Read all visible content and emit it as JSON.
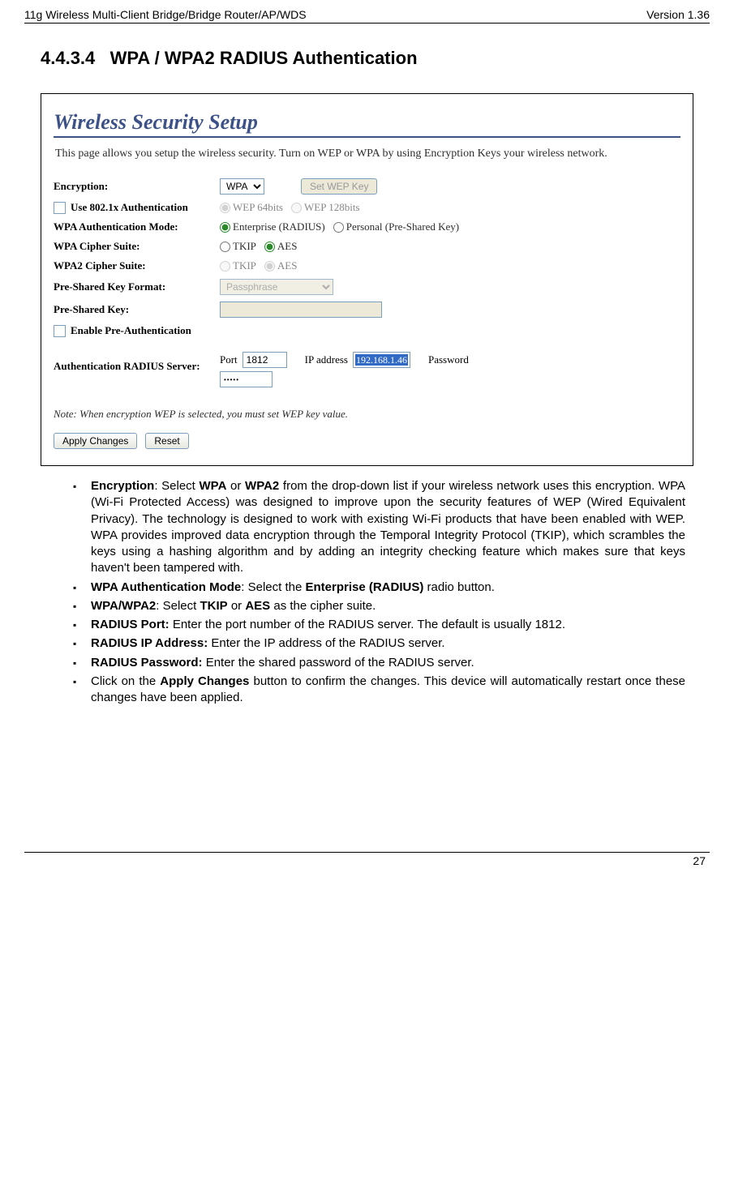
{
  "header": {
    "left": "11g Wireless Multi-Client Bridge/Bridge Router/AP/WDS",
    "right": "Version 1.36"
  },
  "section": {
    "number": "4.4.3.4",
    "title": "WPA / WPA2 RADIUS Authentication"
  },
  "screenshot": {
    "title": "Wireless Security Setup",
    "intro": "This page allows you setup the wireless security. Turn on WEP or WPA by using Encryption Keys your wireless network.",
    "encryption_label": "Encryption:",
    "encryption_value": "WPA",
    "setwepkey_btn": "Set WEP Key",
    "use8021x_label": "Use 802.1x Authentication",
    "wep64_label": "WEP 64bits",
    "wep128_label": "WEP 128bits",
    "wpa_auth_mode_label": "WPA Authentication Mode:",
    "enterprise_label": "Enterprise (RADIUS)",
    "personal_label": "Personal (Pre-Shared Key)",
    "wpa_cipher_label": "WPA Cipher Suite:",
    "wpa2_cipher_label": "WPA2 Cipher Suite:",
    "tkip_label": "TKIP",
    "aes_label": "AES",
    "psk_format_label": "Pre-Shared Key Format:",
    "psk_format_value": "Passphrase",
    "psk_label": "Pre-Shared Key:",
    "enable_preauth_label": "Enable Pre-Authentication",
    "radius_server_label": "Authentication RADIUS Server:",
    "port_label": "Port",
    "port_value": "1812",
    "ip_label": "IP address",
    "ip_value": "192.168.1.46",
    "password_label": "Password",
    "password_value": "•••••",
    "note": "Note: When encryption WEP is selected, you must set WEP key value.",
    "apply_btn": "Apply Changes",
    "reset_btn": "Reset"
  },
  "bullets": {
    "b1_strong": "Encryption",
    "b1_text1": ": Select ",
    "b1_wpa": "WPA",
    "b1_text2": " or ",
    "b1_wpa2": "WPA2",
    "b1_text3": " from the drop-down list if your wireless network uses this encryption. WPA (Wi-Fi Protected Access) was designed to improve upon the security features of WEP (Wired Equivalent Privacy). The technology is designed to work with existing Wi-Fi products that have been enabled with WEP. WPA provides improved data encryption through the Temporal Integrity Protocol (TKIP), which scrambles the keys using a hashing algorithm and by adding an integrity checking feature which makes sure that keys haven't been tampered with.",
    "b2_strong": "WPA Authentication Mode",
    "b2_text1": ": Select the ",
    "b2_enterprise": "Enterprise (RADIUS)",
    "b2_text2": " radio button.",
    "b3_strong": "WPA/WPA2",
    "b3_text1": ": Select ",
    "b3_tkip": "TKIP",
    "b3_text2": " or ",
    "b3_aes": "AES",
    "b3_text3": " as the cipher suite.",
    "b4_strong": "RADIUS Port:",
    "b4_text": " Enter the port number of the RADIUS server. The default is usually 1812.",
    "b5_strong": "RADIUS IP Address:",
    "b5_text": " Enter the IP address of the RADIUS server.",
    "b6_strong": "RADIUS Password:",
    "b6_text": " Enter the shared password of the RADIUS server.",
    "b7_text1": "Click on the ",
    "b7_apply": "Apply Changes",
    "b7_text2": " button to confirm the changes. This device will automatically restart once these changes have been applied."
  },
  "footer": {
    "page": "27"
  }
}
